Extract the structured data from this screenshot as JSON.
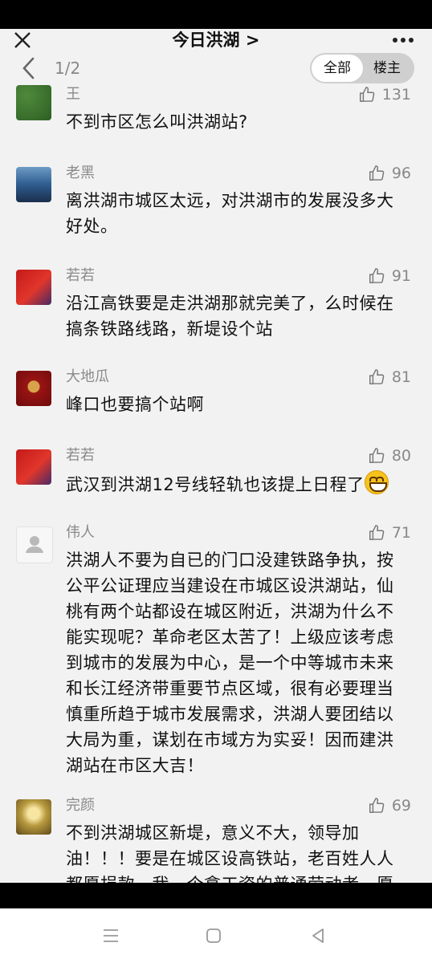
{
  "header": {
    "title": "今日洪湖 >",
    "page_indicator": "1/2",
    "filter_all": "全部",
    "filter_op": "楼主"
  },
  "comments": [
    {
      "user": "王",
      "likes": "131",
      "text": "不到市区怎么叫洪湖站?"
    },
    {
      "user": "老黑",
      "likes": "96",
      "text": "离洪湖市城区太远，对洪湖市的发展没多大好处。"
    },
    {
      "user": "若若",
      "likes": "91",
      "text": "沿江高铁要是走洪湖那就完美了，么时候在搞条铁路线路，新堤设个站"
    },
    {
      "user": "大地瓜",
      "likes": "81",
      "text": "峰口也要搞个站啊"
    },
    {
      "user": "若若",
      "likes": "80",
      "text": "武汉到洪湖12号线轻轨也该提上日程了"
    },
    {
      "user": "伟人",
      "likes": "71",
      "text": "洪湖人不要为自已的门口没建铁路争执，按公平公证理应当建设在市城区设洪湖站，仙桃有两个站都设在城区附近，洪湖为什么不能实现呢？革命老区太苦了！上级应该考虑到城市的发展为中心，是一个中等城市未来和长江经济带重要节点区域，很有必要理当慎重所趋于城市发展需求，洪湖人要团结以大局为重，谋划在市域方为实妥！因而建洪湖站在市区大吉！"
    },
    {
      "user": "完颜",
      "likes": "69",
      "text": "不到洪湖城区新堤，意义不大，领导加油！！！要是在城区设高铁站，老百姓人人都愿捐款，我一个拿工资的普通劳动者，愿"
    }
  ],
  "icons": {
    "close": "close-icon",
    "more": "more-icon",
    "back": "back-icon",
    "like": "thumbs-up-icon",
    "emoji": "grin-emoji-icon"
  },
  "colors": {
    "background": "#f2f2f2",
    "text": "#111111",
    "muted": "#8a8a8a"
  }
}
